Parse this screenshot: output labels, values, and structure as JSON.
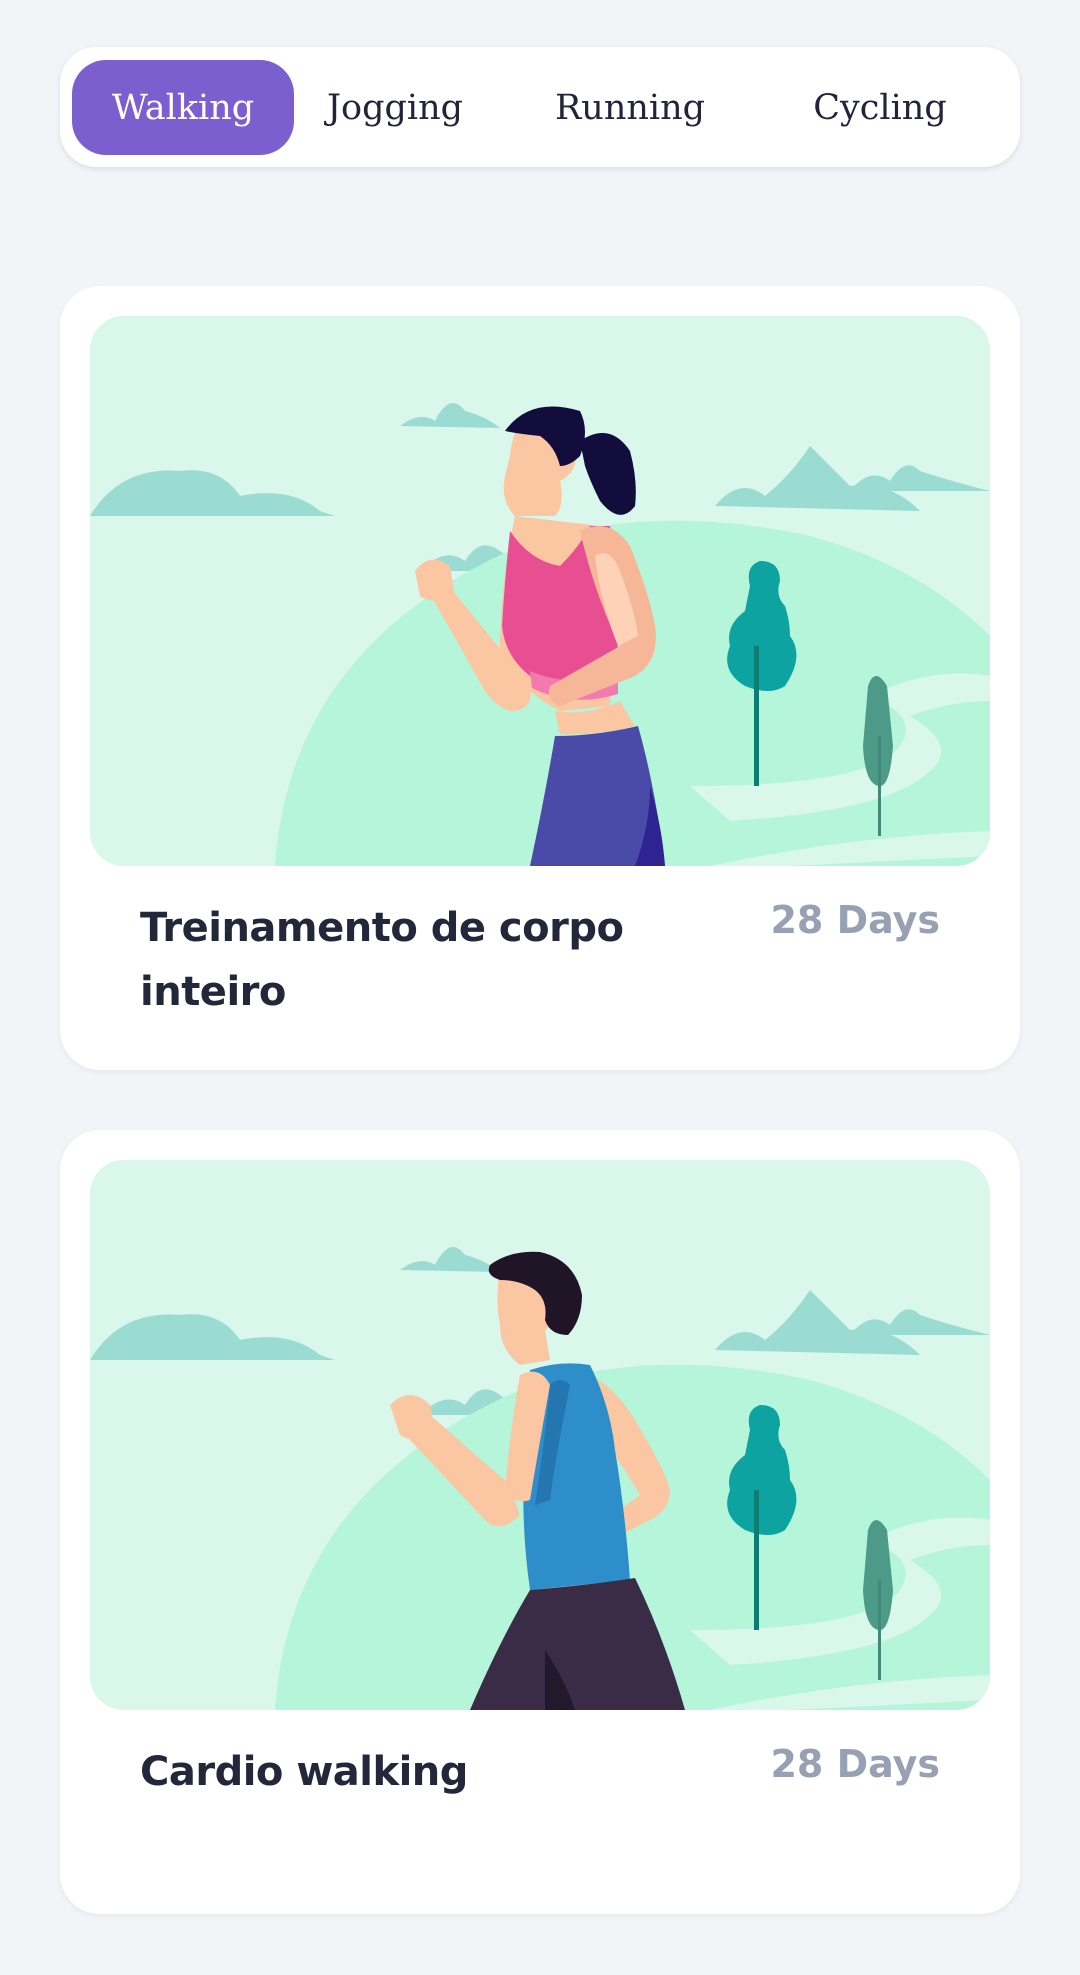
{
  "tabs": [
    {
      "label": "Walking",
      "active": true
    },
    {
      "label": "Jogging",
      "active": false
    },
    {
      "label": "Running",
      "active": false
    },
    {
      "label": "Cycling",
      "active": false
    }
  ],
  "programs": [
    {
      "title": "Treinamento de corpo inteiro",
      "duration": "28 Days",
      "illustration": "woman-jogging-illustration"
    },
    {
      "title": "Cardio walking",
      "duration": "28 Days",
      "illustration": "man-walking-illustration"
    }
  ],
  "colors": {
    "accent": "#7c5fce",
    "page_background": "#f3f4f8",
    "card_background": "#ffffff",
    "title_text": "#22273a",
    "muted_text": "#98a0b3"
  }
}
